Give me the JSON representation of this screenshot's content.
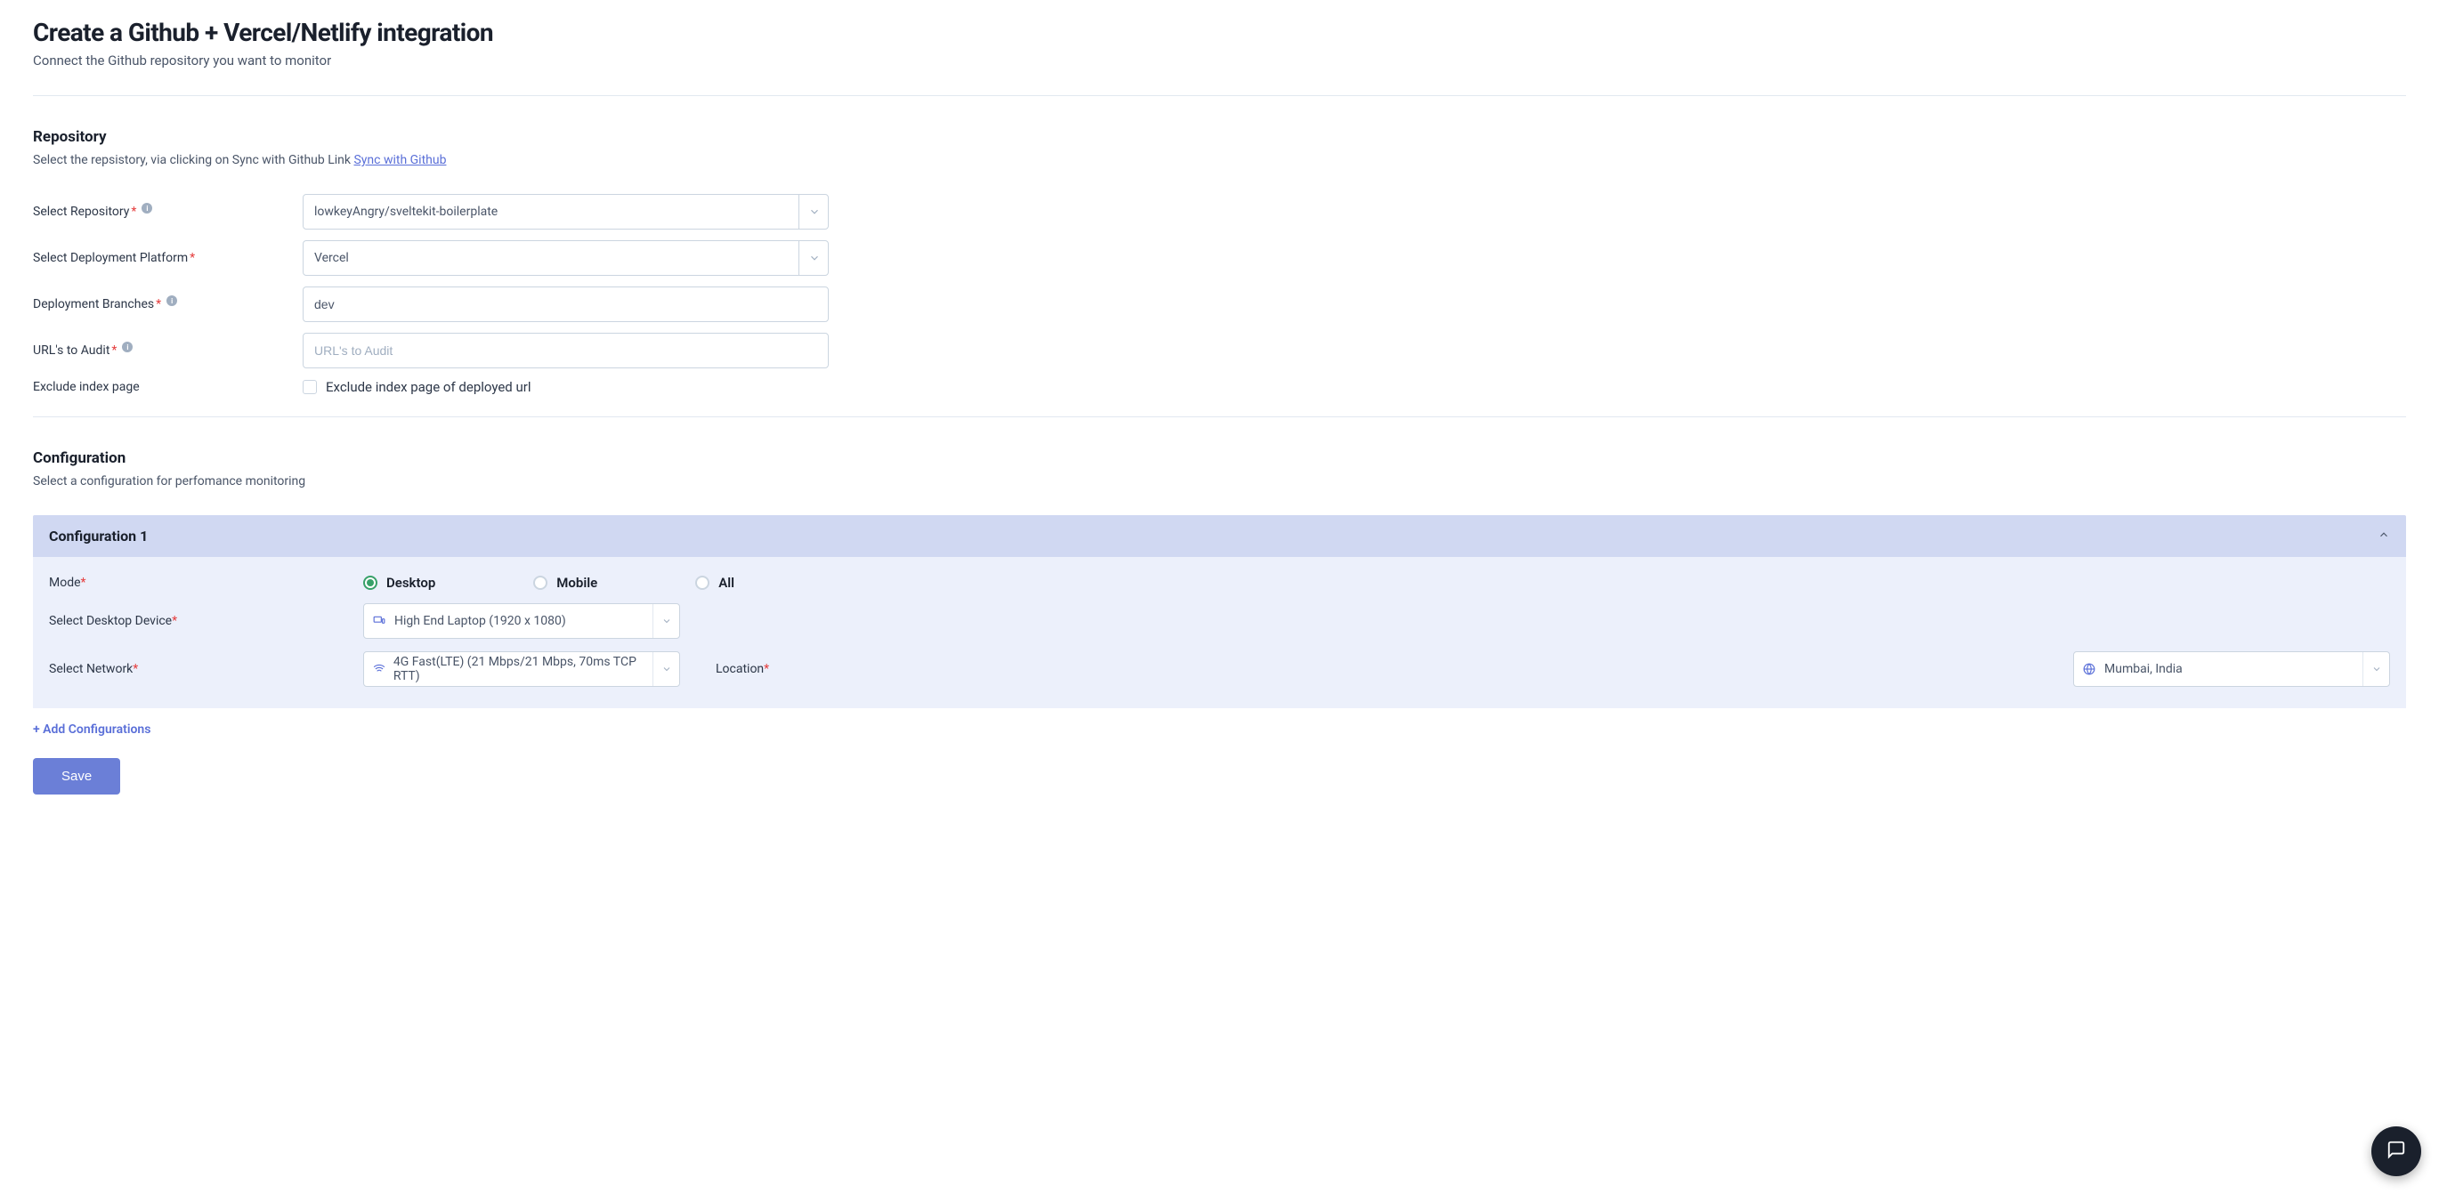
{
  "header": {
    "title": "Create a Github + Vercel/Netlify integration",
    "subtitle": "Connect the Github repository you want to monitor"
  },
  "repository": {
    "section_title": "Repository",
    "section_subtitle_prefix": "Select the repsistory, via clicking on Sync with Github Link ",
    "sync_link": "Sync with Github",
    "select_repo_label": "Select Repository",
    "select_repo_value": "lowkeyAngry/sveltekit-boilerplate",
    "deploy_platform_label": "Select Deployment Platform",
    "deploy_platform_value": "Vercel",
    "branches_label": "Deployment Branches",
    "branches_value": "dev",
    "urls_label": "URL's to Audit",
    "urls_placeholder": "URL's to Audit",
    "exclude_label": "Exclude index page",
    "exclude_checkbox_label": "Exclude index page of deployed url"
  },
  "configuration": {
    "section_title": "Configuration",
    "section_subtitle": "Select a configuration for perfomance monitoring",
    "panel_title": "Configuration 1",
    "mode_label": "Mode",
    "mode_options": {
      "desktop": "Desktop",
      "mobile": "Mobile",
      "all": "All"
    },
    "device_label": "Select Desktop Device",
    "device_value": "High End Laptop (1920 x 1080)",
    "network_label": "Select Network",
    "network_value": "4G Fast(LTE) (21 Mbps/21 Mbps, 70ms TCP RTT)",
    "location_label": "Location",
    "location_value": "Mumbai, India",
    "add_link": "+ Add Configurations"
  },
  "actions": {
    "save": "Save"
  }
}
